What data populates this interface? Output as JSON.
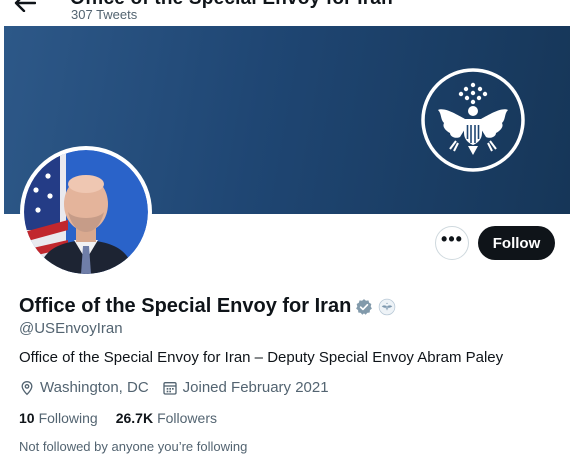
{
  "header": {
    "truncated_title": "Office of the Special Envoy for Iran",
    "tweet_count": "307 Tweets",
    "back_icon": "arrow-left-icon"
  },
  "banner": {
    "seal_icon": "great-seal-eagle-icon",
    "colors": {
      "banner_dark": "#163658",
      "banner_light": "#2d5888"
    }
  },
  "actions": {
    "more_label": "•••",
    "follow_label": "Follow"
  },
  "profile": {
    "display_name": "Office of the Special Envoy for Iran",
    "verified_icon": "verified-badge-icon",
    "affiliate_icon": "affiliate-seal-icon",
    "handle": "@USEnvoyIran",
    "bio": "Office of the Special Envoy for Iran – Deputy Special Envoy Abram Paley",
    "location": "Washington, DC",
    "joined": "Joined February 2021",
    "location_icon": "location-pin-icon",
    "calendar_icon": "calendar-icon"
  },
  "stats": {
    "following_count": "10",
    "following_label": "Following",
    "followers_count": "26.7K",
    "followers_label": "Followers"
  },
  "social_context": "Not followed by anyone you’re following"
}
